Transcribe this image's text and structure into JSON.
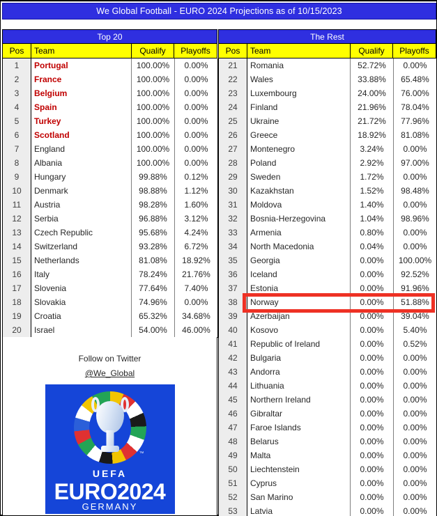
{
  "header": {
    "title": "We Global Football - EURO 2024 Projections as of 10/15/2023",
    "banner_color": "#2F2FE0"
  },
  "tables": {
    "left": {
      "group_title": "Top 20",
      "columns": [
        "Pos",
        "Team",
        "Qualify",
        "Playoffs"
      ],
      "rows": [
        {
          "pos": "1",
          "team": "Portugal",
          "qualify": "100.00%",
          "playoffs": "0.00%",
          "highlight_team": true
        },
        {
          "pos": "2",
          "team": "France",
          "qualify": "100.00%",
          "playoffs": "0.00%",
          "highlight_team": true
        },
        {
          "pos": "3",
          "team": "Belgium",
          "qualify": "100.00%",
          "playoffs": "0.00%",
          "highlight_team": true
        },
        {
          "pos": "4",
          "team": "Spain",
          "qualify": "100.00%",
          "playoffs": "0.00%",
          "highlight_team": true
        },
        {
          "pos": "5",
          "team": "Turkey",
          "qualify": "100.00%",
          "playoffs": "0.00%",
          "highlight_team": true
        },
        {
          "pos": "6",
          "team": "Scotland",
          "qualify": "100.00%",
          "playoffs": "0.00%",
          "highlight_team": true
        },
        {
          "pos": "7",
          "team": "England",
          "qualify": "100.00%",
          "playoffs": "0.00%",
          "highlight_team": false
        },
        {
          "pos": "8",
          "team": "Albania",
          "qualify": "100.00%",
          "playoffs": "0.00%",
          "highlight_team": false
        },
        {
          "pos": "9",
          "team": "Hungary",
          "qualify": "99.88%",
          "playoffs": "0.12%",
          "highlight_team": false
        },
        {
          "pos": "10",
          "team": "Denmark",
          "qualify": "98.88%",
          "playoffs": "1.12%",
          "highlight_team": false
        },
        {
          "pos": "11",
          "team": "Austria",
          "qualify": "98.28%",
          "playoffs": "1.60%",
          "highlight_team": false
        },
        {
          "pos": "12",
          "team": "Serbia",
          "qualify": "96.88%",
          "playoffs": "3.12%",
          "highlight_team": false
        },
        {
          "pos": "13",
          "team": "Czech Republic",
          "qualify": "95.68%",
          "playoffs": "4.24%",
          "highlight_team": false
        },
        {
          "pos": "14",
          "team": "Switzerland",
          "qualify": "93.28%",
          "playoffs": "6.72%",
          "highlight_team": false
        },
        {
          "pos": "15",
          "team": "Netherlands",
          "qualify": "81.08%",
          "playoffs": "18.92%",
          "highlight_team": false
        },
        {
          "pos": "16",
          "team": "Italy",
          "qualify": "78.24%",
          "playoffs": "21.76%",
          "highlight_team": false
        },
        {
          "pos": "17",
          "team": "Slovenia",
          "qualify": "77.64%",
          "playoffs": "7.40%",
          "highlight_team": false
        },
        {
          "pos": "18",
          "team": "Slovakia",
          "qualify": "74.96%",
          "playoffs": "0.00%",
          "highlight_team": false
        },
        {
          "pos": "19",
          "team": "Croatia",
          "qualify": "65.32%",
          "playoffs": "34.68%",
          "highlight_team": false
        },
        {
          "pos": "20",
          "team": "Israel",
          "qualify": "54.00%",
          "playoffs": "46.00%",
          "highlight_team": false
        }
      ]
    },
    "right": {
      "group_title": "The Rest",
      "columns": [
        "Pos",
        "Team",
        "Qualify",
        "Playoffs"
      ],
      "rows": [
        {
          "pos": "21",
          "team": "Romania",
          "qualify": "52.72%",
          "playoffs": "0.00%",
          "row_highlight": false
        },
        {
          "pos": "22",
          "team": "Wales",
          "qualify": "33.88%",
          "playoffs": "65.48%",
          "row_highlight": false
        },
        {
          "pos": "23",
          "team": "Luxembourg",
          "qualify": "24.00%",
          "playoffs": "76.00%",
          "row_highlight": false
        },
        {
          "pos": "24",
          "team": "Finland",
          "qualify": "21.96%",
          "playoffs": "78.04%",
          "row_highlight": false
        },
        {
          "pos": "25",
          "team": "Ukraine",
          "qualify": "21.72%",
          "playoffs": "77.96%",
          "row_highlight": false
        },
        {
          "pos": "26",
          "team": "Greece",
          "qualify": "18.92%",
          "playoffs": "81.08%",
          "row_highlight": false
        },
        {
          "pos": "27",
          "team": "Montenegro",
          "qualify": "3.24%",
          "playoffs": "0.00%",
          "row_highlight": false
        },
        {
          "pos": "28",
          "team": "Poland",
          "qualify": "2.92%",
          "playoffs": "97.00%",
          "row_highlight": false
        },
        {
          "pos": "29",
          "team": "Sweden",
          "qualify": "1.72%",
          "playoffs": "0.00%",
          "row_highlight": false
        },
        {
          "pos": "30",
          "team": "Kazakhstan",
          "qualify": "1.52%",
          "playoffs": "98.48%",
          "row_highlight": false
        },
        {
          "pos": "31",
          "team": "Moldova",
          "qualify": "1.40%",
          "playoffs": "0.00%",
          "row_highlight": false
        },
        {
          "pos": "32",
          "team": "Bosnia-Herzegovina",
          "qualify": "1.04%",
          "playoffs": "98.96%",
          "row_highlight": false
        },
        {
          "pos": "33",
          "team": "Armenia",
          "qualify": "0.80%",
          "playoffs": "0.00%",
          "row_highlight": false
        },
        {
          "pos": "34",
          "team": "North Macedonia",
          "qualify": "0.04%",
          "playoffs": "0.00%",
          "row_highlight": false
        },
        {
          "pos": "35",
          "team": "Georgia",
          "qualify": "0.00%",
          "playoffs": "100.00%",
          "row_highlight": false
        },
        {
          "pos": "36",
          "team": "Iceland",
          "qualify": "0.00%",
          "playoffs": "92.52%",
          "row_highlight": false
        },
        {
          "pos": "37",
          "team": "Estonia",
          "qualify": "0.00%",
          "playoffs": "91.96%",
          "row_highlight": false
        },
        {
          "pos": "38",
          "team": "Norway",
          "qualify": "0.00%",
          "playoffs": "51.88%",
          "row_highlight": true
        },
        {
          "pos": "39",
          "team": "Azerbaijan",
          "qualify": "0.00%",
          "playoffs": "39.04%",
          "row_highlight": false
        },
        {
          "pos": "40",
          "team": "Kosovo",
          "qualify": "0.00%",
          "playoffs": "5.40%",
          "row_highlight": false
        },
        {
          "pos": "41",
          "team": "Republic of Ireland",
          "qualify": "0.00%",
          "playoffs": "0.52%",
          "row_highlight": false
        },
        {
          "pos": "42",
          "team": "Bulgaria",
          "qualify": "0.00%",
          "playoffs": "0.00%",
          "row_highlight": false
        },
        {
          "pos": "43",
          "team": "Andorra",
          "qualify": "0.00%",
          "playoffs": "0.00%",
          "row_highlight": false
        },
        {
          "pos": "44",
          "team": "Lithuania",
          "qualify": "0.00%",
          "playoffs": "0.00%",
          "row_highlight": false
        },
        {
          "pos": "45",
          "team": "Northern Ireland",
          "qualify": "0.00%",
          "playoffs": "0.00%",
          "row_highlight": false
        },
        {
          "pos": "46",
          "team": "Gibraltar",
          "qualify": "0.00%",
          "playoffs": "0.00%",
          "row_highlight": false
        },
        {
          "pos": "47",
          "team": "Faroe Islands",
          "qualify": "0.00%",
          "playoffs": "0.00%",
          "row_highlight": false
        },
        {
          "pos": "48",
          "team": "Belarus",
          "qualify": "0.00%",
          "playoffs": "0.00%",
          "row_highlight": false
        },
        {
          "pos": "49",
          "team": "Malta",
          "qualify": "0.00%",
          "playoffs": "0.00%",
          "row_highlight": false
        },
        {
          "pos": "50",
          "team": "Liechtenstein",
          "qualify": "0.00%",
          "playoffs": "0.00%",
          "row_highlight": false
        },
        {
          "pos": "51",
          "team": "Cyprus",
          "qualify": "0.00%",
          "playoffs": "0.00%",
          "row_highlight": false
        },
        {
          "pos": "52",
          "team": "San Marino",
          "qualify": "0.00%",
          "playoffs": "0.00%",
          "row_highlight": false
        },
        {
          "pos": "53",
          "team": "Latvia",
          "qualify": "0.00%",
          "playoffs": "0.00%",
          "row_highlight": false
        }
      ]
    }
  },
  "promo": {
    "follow_text": "Follow on Twitter",
    "handle": "@We_Global",
    "logo": {
      "uefa": "UEFA",
      "euro": "EURO2024",
      "country": "GERMANY",
      "tm": "™",
      "background_color": "#1545D8"
    }
  },
  "colors": {
    "banner_blue": "#2F2FE0",
    "header_yellow": "#FFFF00",
    "highlight_red": "#EE3124",
    "team_red": "#C00000"
  }
}
